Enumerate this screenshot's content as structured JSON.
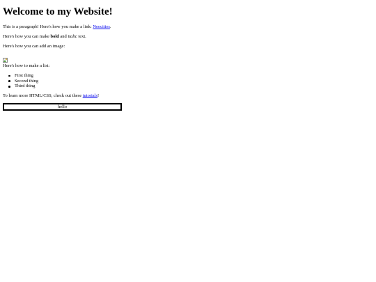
{
  "heading": "Welcome to my Website!",
  "paragraph1": {
    "before": "This is a paragraph! Here's how you make a link: ",
    "link": "Neocities",
    "after": "."
  },
  "paragraph2": {
    "before": "Here's how you can make ",
    "bold": "bold",
    "middle": " and ",
    "italic": "italic",
    "after": " text."
  },
  "paragraph3": "Here's how you can add an image:",
  "image_icon": "broken-image-icon",
  "paragraph4": "Here's how to make a list:",
  "list": [
    "First thing",
    "Second thing",
    "Third thing"
  ],
  "paragraph5": {
    "before": "To learn more HTML/CSS, check out these ",
    "link": "tutorials",
    "after": "!"
  },
  "button_label": "hello",
  "colors": {
    "text": "#000000",
    "link": "#0000ee",
    "background": "#ffffff"
  }
}
